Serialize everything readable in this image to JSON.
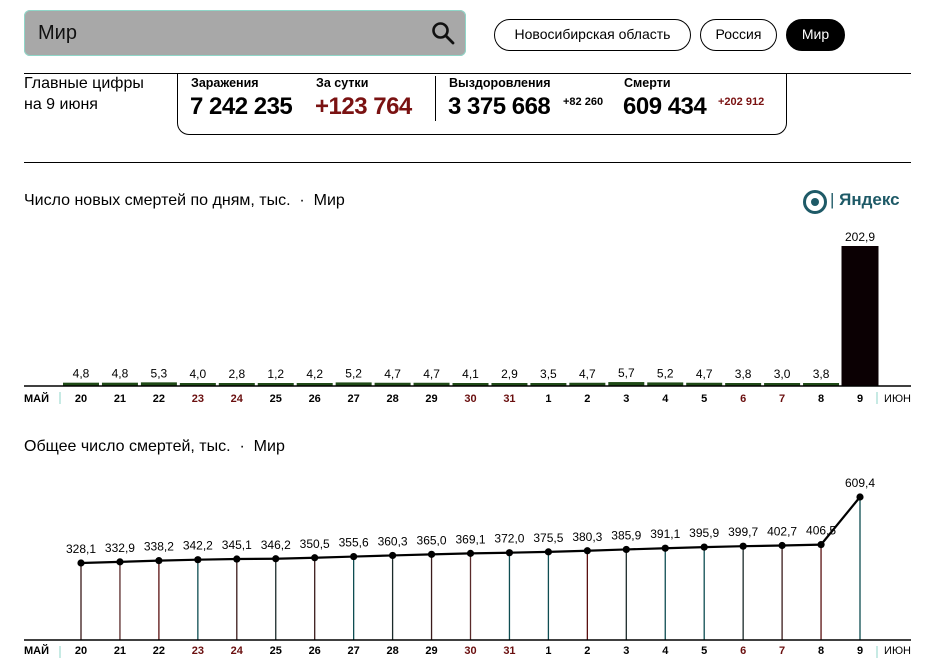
{
  "search": {
    "value": "Мир"
  },
  "regions": [
    {
      "label": "Новосибирская область",
      "active": false
    },
    {
      "label": "Россия",
      "active": false
    },
    {
      "label": "Мир",
      "active": true
    }
  ],
  "headline": {
    "line1": "Главные цифры",
    "line2": "на 9 июня"
  },
  "stats": {
    "infections_label": "Заражения",
    "infections_value": "7 242 235",
    "daily_label": "За сутки",
    "daily_value": "+123 764",
    "recoveries_label": "Выздоровления",
    "recoveries_value": "3 375 668",
    "recoveries_delta": "+82 260",
    "deaths_label": "Смерти",
    "deaths_value": "609 434",
    "deaths_delta": "+202 912"
  },
  "logo": {
    "text": "Яндекс"
  },
  "chart_data": [
    {
      "type": "bar",
      "title": "Число новых смертей по дням, тыс.",
      "region": "Мир",
      "month_start": "МАЙ",
      "month_end": "ИЮН",
      "categories": [
        "20",
        "21",
        "22",
        "23",
        "24",
        "25",
        "26",
        "27",
        "28",
        "29",
        "30",
        "31",
        "1",
        "2",
        "3",
        "4",
        "5",
        "6",
        "7",
        "8",
        "9"
      ],
      "weekend": [
        false,
        false,
        false,
        true,
        true,
        false,
        false,
        false,
        false,
        false,
        true,
        true,
        false,
        false,
        false,
        false,
        false,
        true,
        true,
        false,
        false
      ],
      "values": [
        4.8,
        4.8,
        5.3,
        4.0,
        2.8,
        1.2,
        4.2,
        5.2,
        4.7,
        4.7,
        4.1,
        2.9,
        3.5,
        4.7,
        5.7,
        5.2,
        4.7,
        3.8,
        3.0,
        3.8,
        202.9
      ],
      "labels": [
        "4,8",
        "4,8",
        "5,3",
        "4,0",
        "2,8",
        "1,2",
        "4,2",
        "5,2",
        "4,7",
        "4,7",
        "4,1",
        "2,9",
        "3,5",
        "4,7",
        "5,7",
        "5,2",
        "4,7",
        "3,8",
        "3,0",
        "3,8",
        "202,9"
      ],
      "ylim": [
        0,
        202.9
      ],
      "bar_color": "#1f4a16",
      "highlight_color": "#0b0003"
    },
    {
      "type": "line",
      "title": "Общее число смертей, тыс.",
      "region": "Мир",
      "month_start": "МАЙ",
      "month_end": "ИЮН",
      "categories": [
        "20",
        "21",
        "22",
        "23",
        "24",
        "25",
        "26",
        "27",
        "28",
        "29",
        "30",
        "31",
        "1",
        "2",
        "3",
        "4",
        "5",
        "6",
        "7",
        "8",
        "9"
      ],
      "weekend": [
        false,
        false,
        false,
        true,
        true,
        false,
        false,
        false,
        false,
        false,
        true,
        true,
        false,
        false,
        false,
        false,
        false,
        true,
        true,
        false,
        false
      ],
      "values": [
        328.1,
        332.9,
        338.2,
        342.2,
        345.1,
        346.2,
        350.5,
        355.6,
        360.3,
        365.0,
        369.1,
        372.0,
        375.5,
        380.3,
        385.9,
        391.1,
        395.9,
        399.7,
        402.7,
        406.5,
        609.4
      ],
      "labels": [
        "328,1",
        "332,9",
        "338,2",
        "342,2",
        "345,1",
        "346,2",
        "350,5",
        "355,6",
        "360,3",
        "365,0",
        "369,1",
        "372,0",
        "375,5",
        "380,3",
        "385,9",
        "391,1",
        "395,9",
        "399,7",
        "402,7",
        "406,5",
        "609,4"
      ],
      "ylim": [
        0,
        609.4
      ],
      "stem_colors": [
        "#3a1a1a",
        "#5a2a2a",
        "#5a1010",
        "#0e4d52",
        "#3a1a1a",
        "#1a2a2a",
        "#3a1a1a",
        "#0e4d52",
        "#1a2a2a",
        "#3a1a1a",
        "#5a2a2a",
        "#0e4d52",
        "#0e4d52",
        "#5a1010",
        "#1a2a2a",
        "#0e4d52",
        "#0e4d52",
        "#1a2a2a",
        "#3a1a1a",
        "#5a1010",
        "#0e4d52"
      ]
    }
  ]
}
